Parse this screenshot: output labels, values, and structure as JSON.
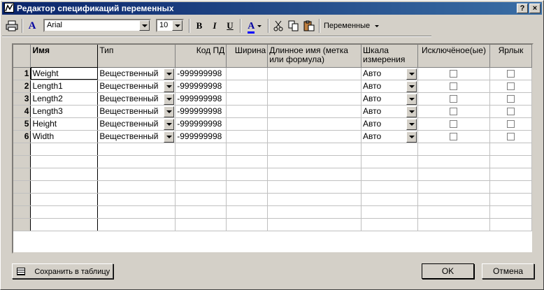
{
  "window": {
    "title": "Редактор спецификаций переменных",
    "help_button": "?",
    "close_button": "×"
  },
  "toolbar": {
    "font_name": "Arial",
    "font_size": "10",
    "bold_label": "B",
    "italic_label": "I",
    "underline_label": "U",
    "font_color_label": "A",
    "text_style_label": "A",
    "variables_menu_label": "Переменные"
  },
  "grid": {
    "columns": [
      "Имя",
      "Тип",
      "Код ПД",
      "Ширина",
      "Длинное имя (метка или формула)",
      "Шкала измерения",
      "Исключёное(ые)",
      "Ярлык"
    ],
    "rows": [
      {
        "num": "1",
        "name": "Weight",
        "type": "Вещественный",
        "code": "-999999998",
        "width": "",
        "long_name": "",
        "scale": "Авто",
        "excluded": false,
        "label": false
      },
      {
        "num": "2",
        "name": "Length1",
        "type": "Вещественный",
        "code": "-999999998",
        "width": "",
        "long_name": "",
        "scale": "Авто",
        "excluded": false,
        "label": false
      },
      {
        "num": "3",
        "name": "Length2",
        "type": "Вещественный",
        "code": "-999999998",
        "width": "",
        "long_name": "",
        "scale": "Авто",
        "excluded": false,
        "label": false
      },
      {
        "num": "4",
        "name": "Length3",
        "type": "Вещественный",
        "code": "-999999998",
        "width": "",
        "long_name": "",
        "scale": "Авто",
        "excluded": false,
        "label": false
      },
      {
        "num": "5",
        "name": "Height",
        "type": "Вещественный",
        "code": "-999999998",
        "width": "",
        "long_name": "",
        "scale": "Авто",
        "excluded": false,
        "label": false
      },
      {
        "num": "6",
        "name": "Width",
        "type": "Вещественный",
        "code": "-999999998",
        "width": "",
        "long_name": "",
        "scale": "Авто",
        "excluded": false,
        "label": false
      }
    ]
  },
  "buttons": {
    "save_to_table": "Сохранить в таблицу",
    "ok": "OK",
    "cancel": "Отмена"
  }
}
